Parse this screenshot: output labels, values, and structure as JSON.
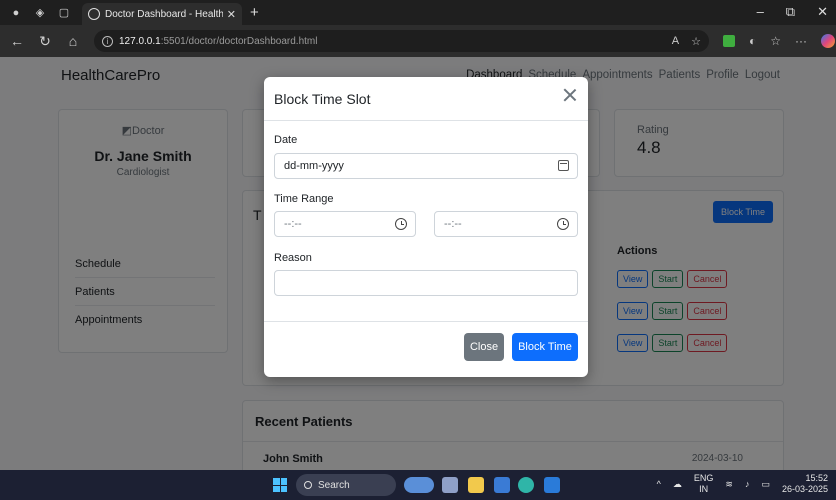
{
  "browser": {
    "tab_title": "Doctor Dashboard - HealthCareP",
    "url_host": "127.0.0.1",
    "url_path": ":5501/doctor/doctorDashboard.html"
  },
  "navbar": {
    "brand": "HealthCarePro",
    "links": [
      "Dashboard",
      "Schedule",
      "Appointments",
      "Patients",
      "Profile",
      "Logout"
    ]
  },
  "profile": {
    "avatar_alt": "Doctor",
    "name": "Dr. Jane Smith",
    "specialty": "Cardiologist",
    "menu": [
      "Schedule",
      "Patients",
      "Appointments"
    ]
  },
  "stats": {
    "rating_label": "Rating",
    "rating_value": "4.8"
  },
  "appointments": {
    "title_initial": "T",
    "block_time_button": "Block Time",
    "actions_header": "Actions",
    "row_buttons": {
      "view": "View",
      "start": "Start",
      "cancel": "Cancel"
    }
  },
  "recent_patients": {
    "title": "Recent Patients",
    "items": [
      {
        "name": "John Smith",
        "date": "2024-03-10"
      }
    ]
  },
  "modal": {
    "title": "Block Time Slot",
    "date_label": "Date",
    "date_placeholder": "dd-mm-yyyy",
    "time_label": "Time Range",
    "time_start_placeholder": "--:--",
    "time_end_placeholder": "--:--",
    "reason_label": "Reason",
    "reason_value": "",
    "close_button": "Close",
    "submit_button": "Block Time"
  },
  "taskbar": {
    "search_label": "Search",
    "lang_top": "ENG",
    "lang_bottom": "IN",
    "time": "15:52",
    "date": "26-03-2025"
  }
}
